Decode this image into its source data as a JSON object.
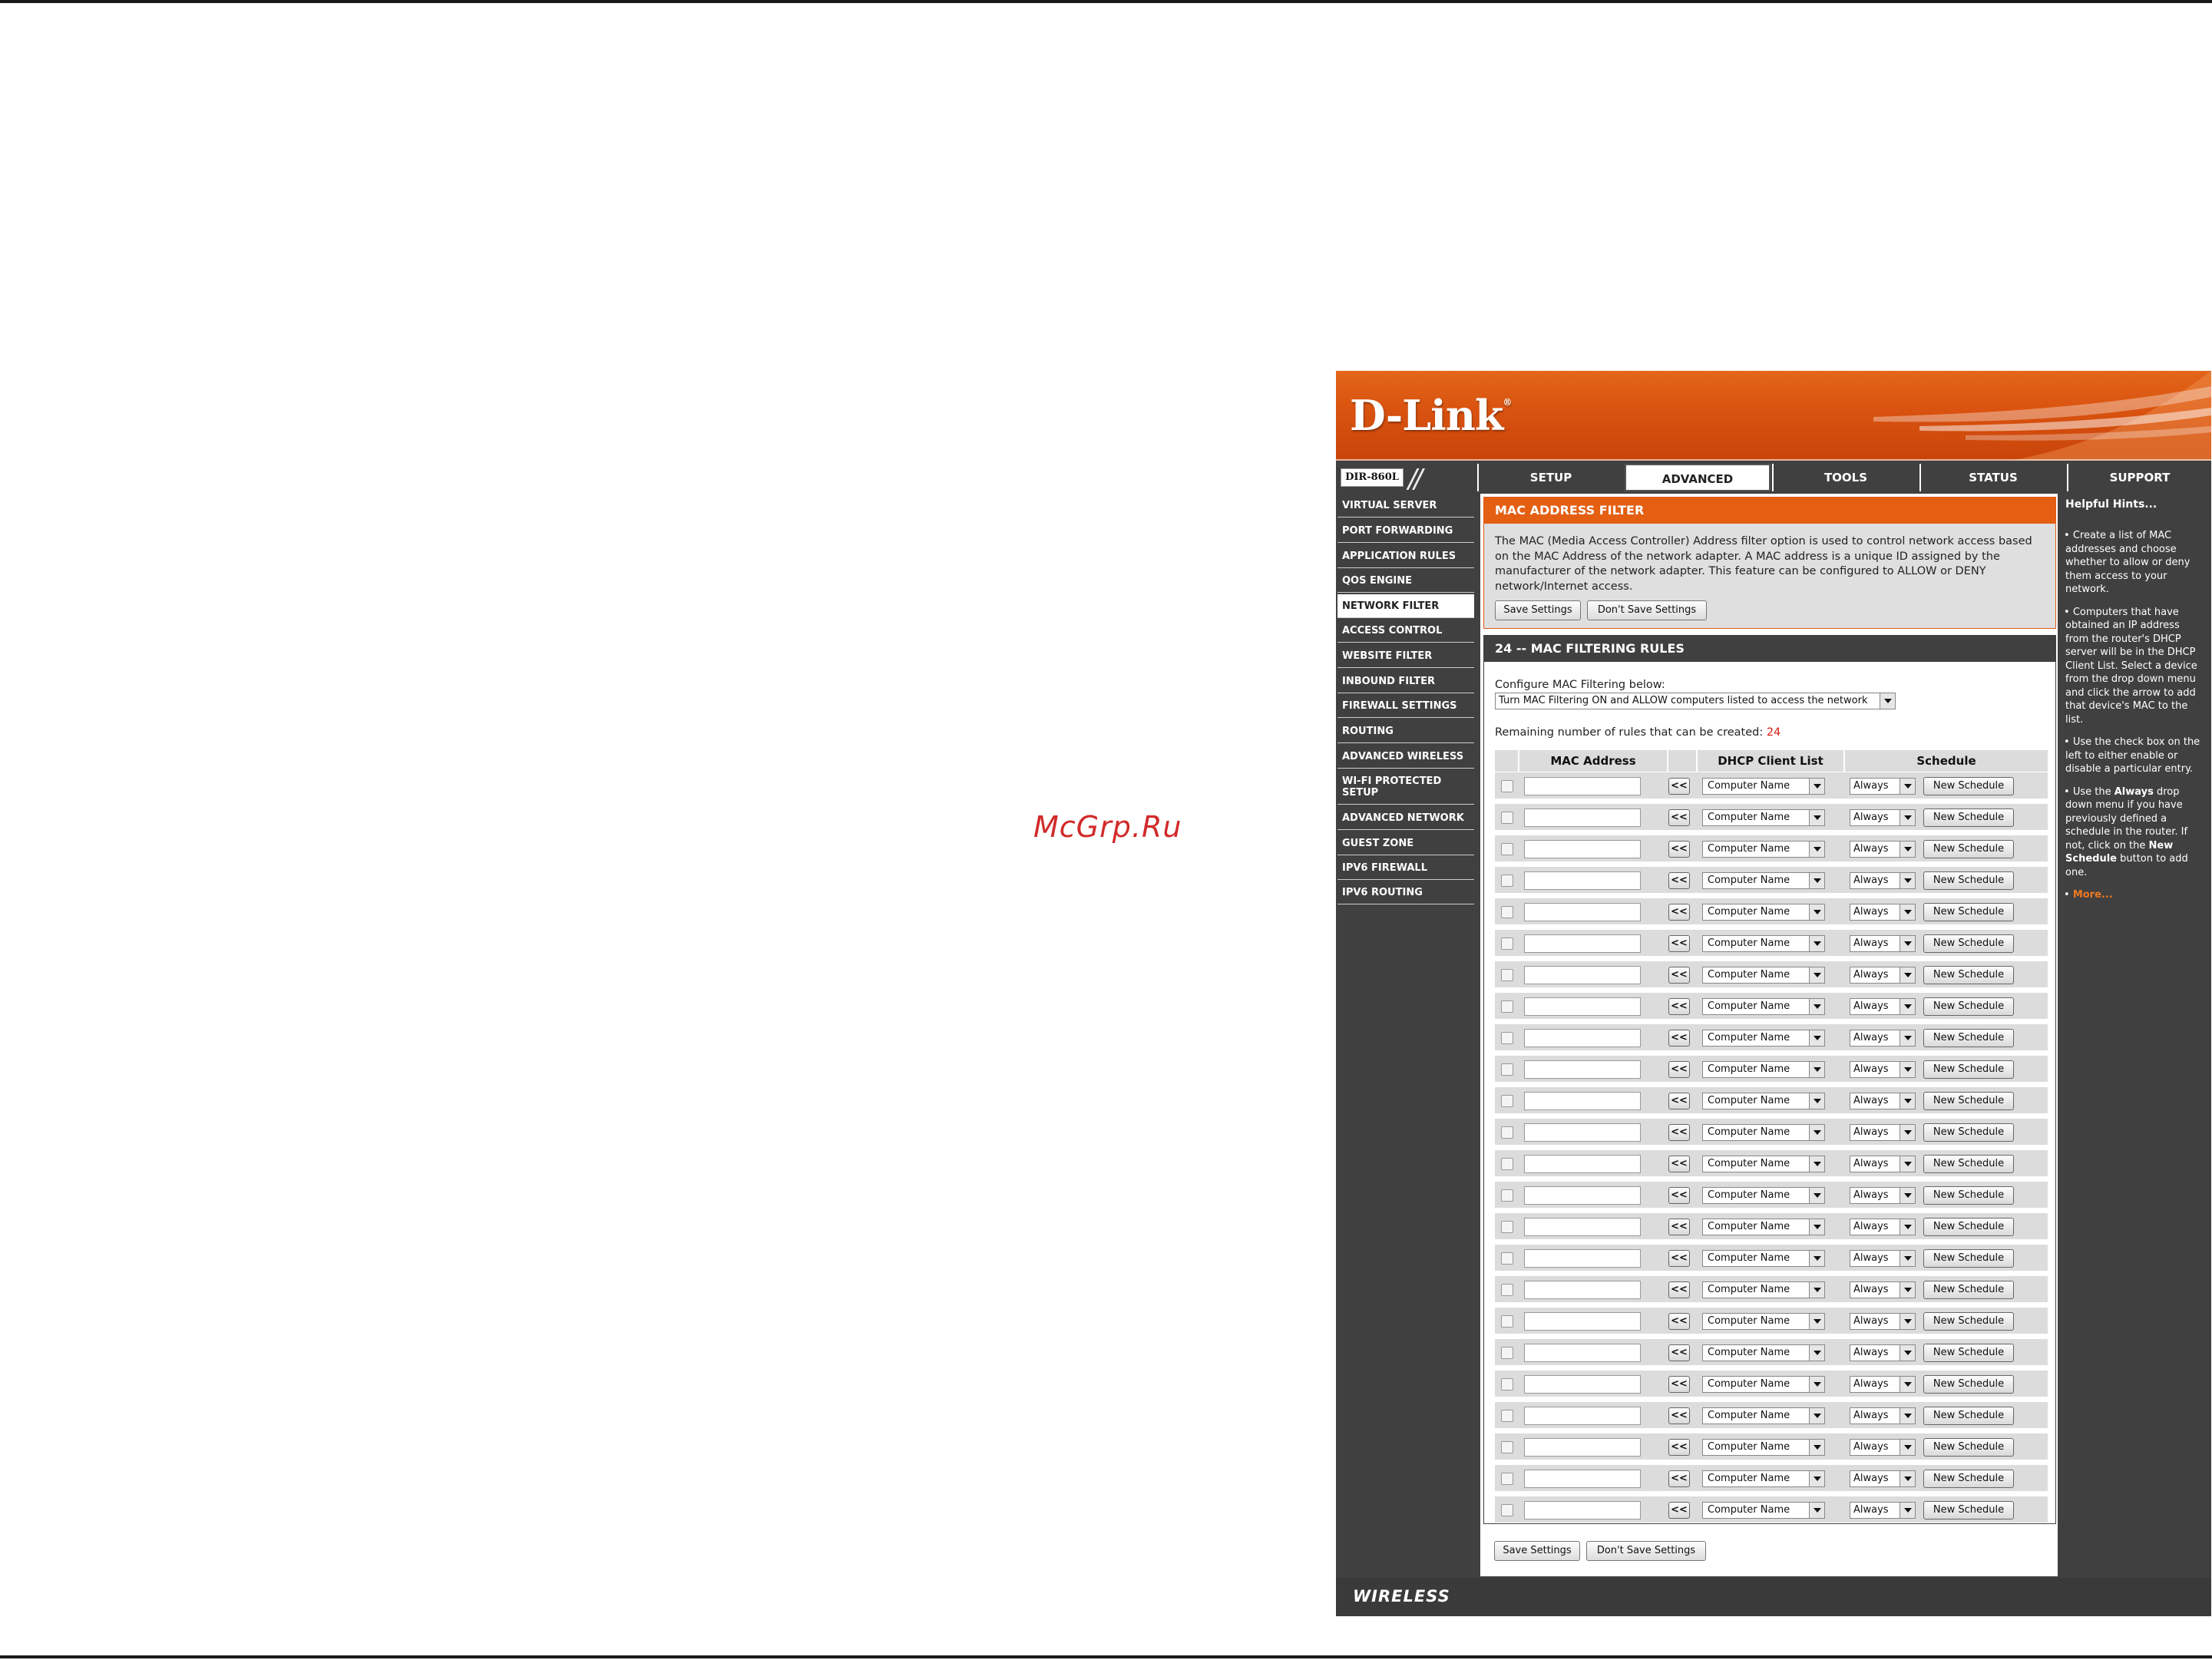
{
  "watermark": "McGrp.Ru",
  "brand": {
    "logo": "D-Link",
    "model": "DIR-860L"
  },
  "tabs": [
    {
      "label": "SETUP"
    },
    {
      "label": "ADVANCED"
    },
    {
      "label": "TOOLS"
    },
    {
      "label": "STATUS"
    },
    {
      "label": "SUPPORT"
    }
  ],
  "sidebar": [
    "VIRTUAL SERVER",
    "PORT FORWARDING",
    "APPLICATION RULES",
    "QOS ENGINE",
    "NETWORK FILTER",
    "ACCESS CONTROL",
    "WEBSITE FILTER",
    "INBOUND FILTER",
    "FIREWALL SETTINGS",
    "ROUTING",
    "ADVANCED WIRELESS",
    "WI-FI PROTECTED SETUP",
    "ADVANCED NETWORK",
    "GUEST ZONE",
    "IPV6 FIREWALL",
    "IPV6 ROUTING"
  ],
  "mac_filter": {
    "title": "MAC ADDRESS FILTER",
    "description": "The MAC (Media Access Controller) Address filter option is used to control network access based on the MAC Address of the network adapter. A MAC address is a unique ID assigned by the manufacturer of the network adapter. This feature can be configured to ALLOW or DENY network/Internet access.",
    "save_label": "Save Settings",
    "dont_save_label": "Don't Save Settings"
  },
  "rules": {
    "title": "24 -- MAC FILTERING RULES",
    "configure_label": "Configure MAC Filtering below:",
    "configure_value": "Turn MAC Filtering ON and ALLOW computers listed to access the network",
    "remaining_label": "Remaining number of rules that can be created:",
    "remaining_count": "24",
    "col_mac": "MAC Address",
    "col_dhcp": "DHCP Client List",
    "col_schedule": "Schedule",
    "row_count": 24,
    "arrow_label": "<<",
    "pc_placeholder": "Computer Name",
    "schedule_value": "Always",
    "new_schedule_label": "New Schedule"
  },
  "bottom_buttons": {
    "save_label": "Save Settings",
    "dont_save_label": "Don't Save Settings"
  },
  "hints": {
    "title": "Helpful Hints...",
    "more": "More..."
  },
  "footer": {
    "text": "WIRELESS"
  },
  "colors": {
    "accent": "#e45f12",
    "chrome": "#404040",
    "remaining_count": "#d8190f"
  }
}
